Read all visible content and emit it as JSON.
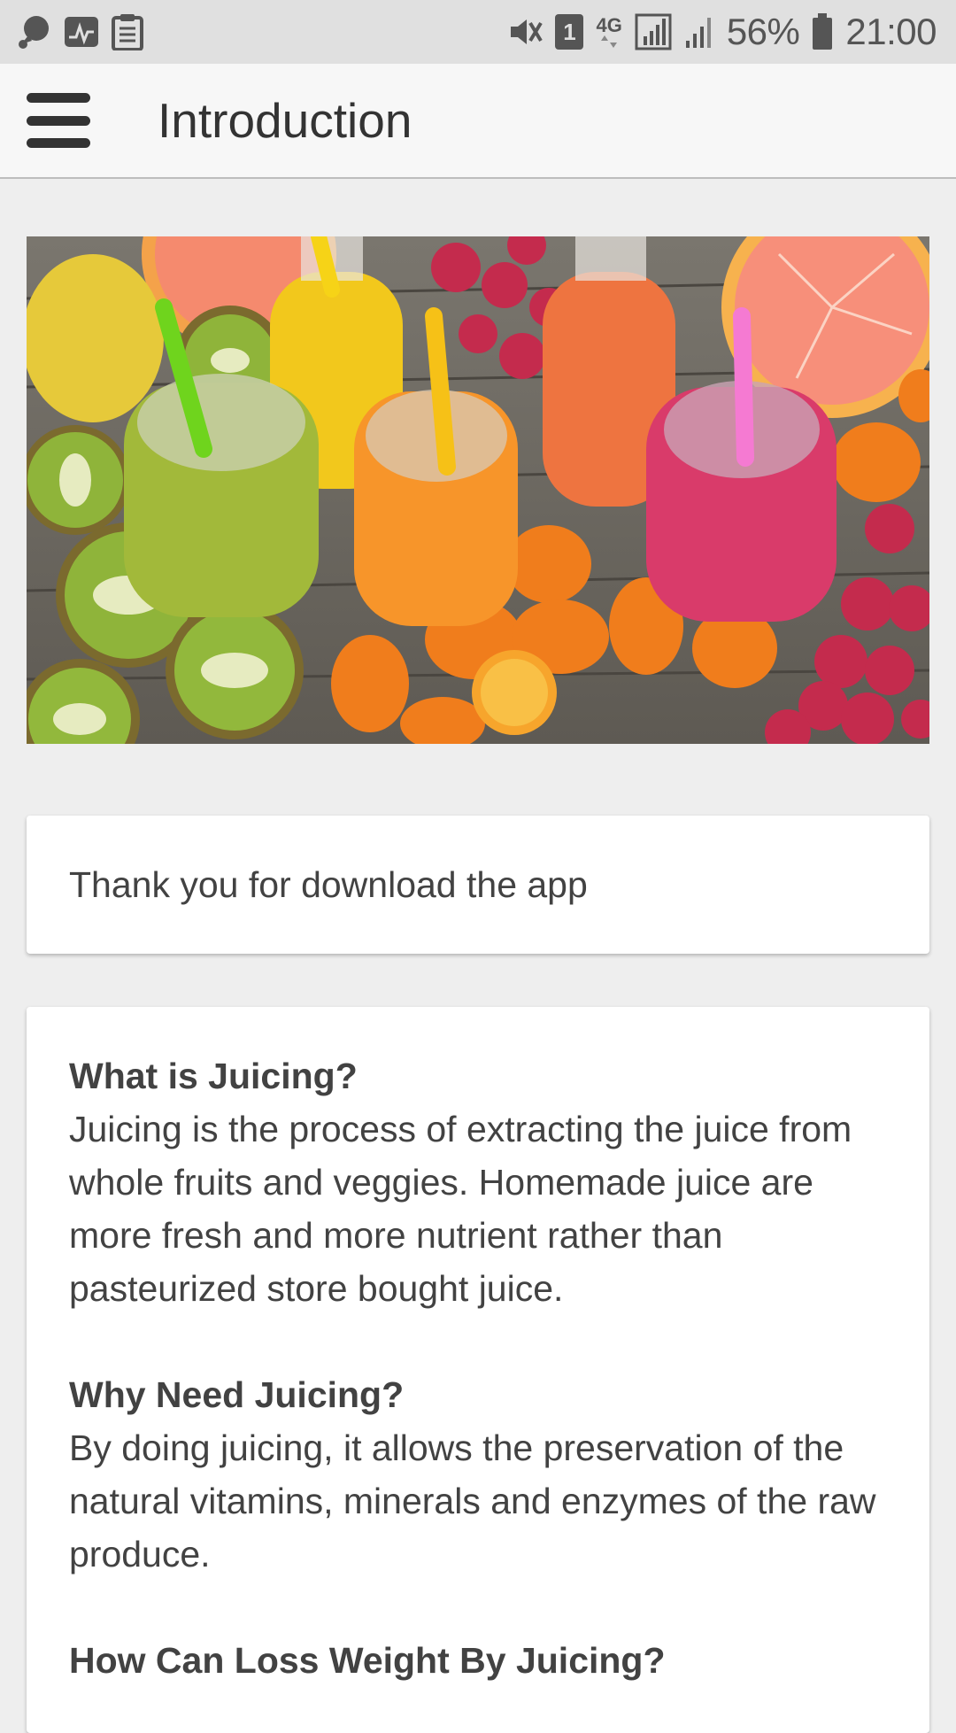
{
  "status_bar": {
    "battery": "56%",
    "time": "21:00",
    "sim_badge": "1",
    "network": "4G",
    "icons": [
      "chat-icon",
      "activity-icon",
      "clipboard-icon",
      "mute-vibrate-icon",
      "sim-icon",
      "4g-data-icon",
      "signal-icon",
      "signal-2-icon",
      "battery-icon"
    ]
  },
  "app_bar": {
    "title": "Introduction",
    "menu_icon": "hamburger-menu-icon"
  },
  "hero": {
    "icon": "juice-bottles-fruit-image"
  },
  "thanks_card": {
    "text": "Thank you for download the app"
  },
  "info_card": {
    "sections": [
      {
        "heading": "What is Juicing?",
        "body": "Juicing is the process of extracting the juice from whole fruits and veggies. Homemade juice are more fresh and more nutrient rather than pasteurized store bought juice."
      },
      {
        "heading": "Why Need Juicing?",
        "body": "By doing juicing, it allows the preservation of the natural vitamins, minerals and enzymes of the raw produce."
      },
      {
        "heading": "How Can Loss Weight By Juicing?",
        "body": ""
      }
    ]
  },
  "colors": {
    "status_bar_bg": "#e0e0e0",
    "app_bar_bg": "#f7f7f7",
    "page_bg": "#eeeeee",
    "card_bg": "#ffffff",
    "text": "#424242"
  }
}
